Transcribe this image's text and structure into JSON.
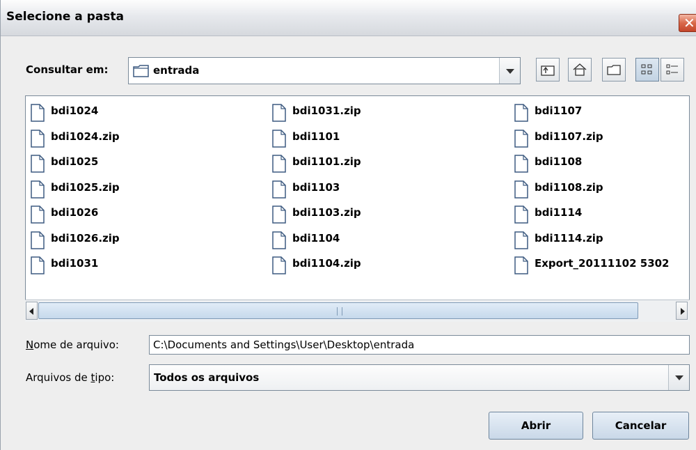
{
  "window": {
    "title": "Selecione a pasta"
  },
  "look_in": {
    "label": "Consultar em:",
    "value": "entrada"
  },
  "toolbar": {
    "up_one_level": "up-folder-icon",
    "home": "home-icon",
    "new_folder": "new-folder-icon",
    "list_view": "list-view-icon",
    "details_view": "details-view-icon"
  },
  "files": {
    "col1": [
      "bdi1024",
      "bdi1024.zip",
      "bdi1025",
      "bdi1025.zip",
      "bdi1026",
      "bdi1026.zip",
      "bdi1031"
    ],
    "col2": [
      "bdi1031.zip",
      "bdi1101",
      "bdi1101.zip",
      "bdi1103",
      "bdi1103.zip",
      "bdi1104",
      "bdi1104.zip"
    ],
    "col3": [
      "bdi1107",
      "bdi1107.zip",
      "bdi1108",
      "bdi1108.zip",
      "bdi1114",
      "bdi1114.zip",
      "Export_20111102 5302"
    ]
  },
  "filename": {
    "label_prefix": "N",
    "label_rest": "ome de arquivo:",
    "value": "C:\\Documents and Settings\\User\\Desktop\\entrada"
  },
  "filetype": {
    "label_prefix": "Arquivos de ",
    "label_u": "t",
    "label_rest": "ipo:",
    "value": "Todos os arquivos"
  },
  "buttons": {
    "open": "Abrir",
    "cancel": "Cancelar"
  }
}
